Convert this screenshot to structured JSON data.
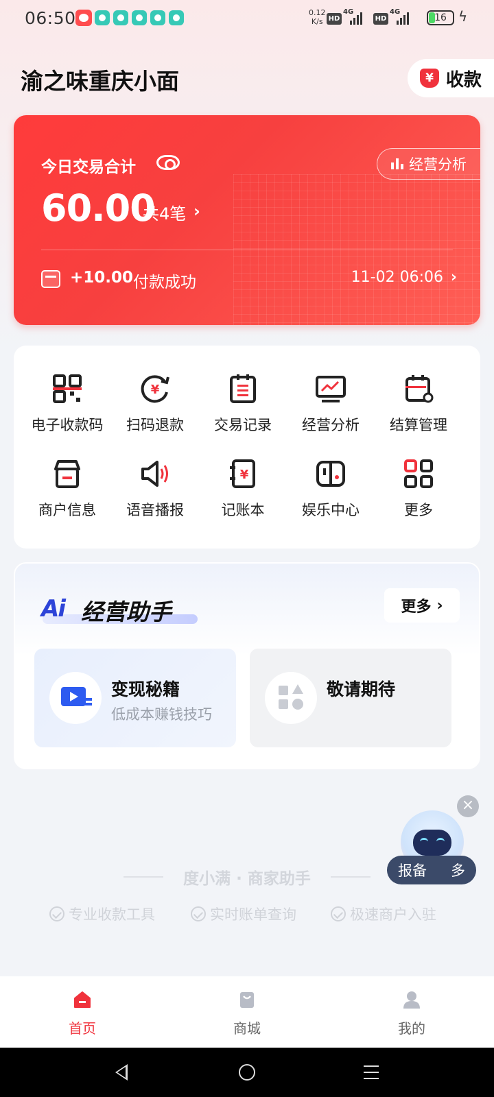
{
  "status_bar": {
    "time": "06:50",
    "speed_value": "0.12",
    "speed_unit": "K/s",
    "hd_label": "HD",
    "network_label": "4G",
    "battery": "16"
  },
  "header": {
    "shop_name": "渝之味重庆小面",
    "collect_icon": "¥",
    "collect_label": "收款"
  },
  "trade_card": {
    "title": "今日交易合计",
    "analysis_label": "经营分析",
    "amount": "60.00",
    "count": "共4笔",
    "last_amount": "+10.00",
    "last_status": "付款成功",
    "last_time": "11-02 06:06"
  },
  "menu": {
    "items": [
      {
        "label": "电子收款码",
        "icon": "qr-code-icon"
      },
      {
        "label": "扫码退款",
        "icon": "refund-icon"
      },
      {
        "label": "交易记录",
        "icon": "records-icon"
      },
      {
        "label": "经营分析",
        "icon": "analysis-icon"
      },
      {
        "label": "结算管理",
        "icon": "settlement-icon"
      },
      {
        "label": "商户信息",
        "icon": "store-icon"
      },
      {
        "label": "语音播报",
        "icon": "speaker-icon"
      },
      {
        "label": "记账本",
        "icon": "ledger-icon"
      },
      {
        "label": "娱乐中心",
        "icon": "game-icon"
      },
      {
        "label": "更多",
        "icon": "more-grid-icon"
      }
    ]
  },
  "ai_assistant": {
    "logo": "Ai",
    "title": "经营助手",
    "more_label": "更多",
    "cards": [
      {
        "title": "变现秘籍",
        "desc": "低成本赚钱技巧"
      },
      {
        "title": "敬请期待",
        "desc": ""
      }
    ]
  },
  "footer_brand": {
    "title": "度小满 · 商家助手",
    "features": [
      "专业收款工具",
      "实时账单查询",
      "极速商户入驻"
    ]
  },
  "robot": {
    "left_text": "报备",
    "right_text": "多",
    "close": "×"
  },
  "tabbar": {
    "tabs": [
      {
        "label": "首页",
        "icon": "home-icon",
        "active": true
      },
      {
        "label": "商城",
        "icon": "shop-bag-icon",
        "active": false
      },
      {
        "label": "我的",
        "icon": "profile-icon",
        "active": false
      }
    ]
  },
  "colors": {
    "accent": "#f0323c",
    "ai_blue": "#2d44d8"
  }
}
